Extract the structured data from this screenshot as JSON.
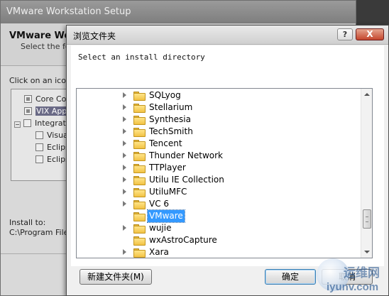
{
  "background_window": {
    "title": "VMware Workstation Setup",
    "header_title": "VMware Wo",
    "header_subtitle": "Select the fe",
    "click_text": "Click on an icon",
    "tree_items": [
      {
        "label": "Core Co",
        "checked": true
      },
      {
        "label": "VIX Appl",
        "checked": true,
        "highlighted": true
      },
      {
        "label": "Integrat",
        "expander": "−"
      },
      {
        "label": "Visua"
      },
      {
        "label": "Eclips"
      },
      {
        "label": "Eclips"
      }
    ],
    "install_to_label": "Install to:",
    "install_path": "C:\\Program Files"
  },
  "dialog": {
    "title": "浏览文件夹",
    "help_label": "?",
    "close_label": "X",
    "instruction": "Select an install directory",
    "folders": [
      {
        "label": "SQLyog",
        "expandable": true
      },
      {
        "label": "Stellarium",
        "expandable": true
      },
      {
        "label": "Synthesia",
        "expandable": true
      },
      {
        "label": "TechSmith",
        "expandable": true
      },
      {
        "label": "Tencent",
        "expandable": true
      },
      {
        "label": "Thunder Network",
        "expandable": true
      },
      {
        "label": "TTPlayer",
        "expandable": true
      },
      {
        "label": "Utilu IE Collection",
        "expandable": true
      },
      {
        "label": "UtiluMFC",
        "expandable": true
      },
      {
        "label": "VC 6",
        "expandable": true
      },
      {
        "label": "VMware",
        "expandable": false,
        "selected": true
      },
      {
        "label": "wujie",
        "expandable": true
      },
      {
        "label": "wxAstroCapture",
        "expandable": false
      },
      {
        "label": "Xara",
        "expandable": true
      }
    ],
    "new_folder_label": "新建文件夹(M)",
    "ok_label": "确定",
    "cancel_label": "取消"
  },
  "watermark": {
    "text": "运维网",
    "url": "iyunv.com"
  },
  "colors": {
    "selection": "#3399ff",
    "folder": "#f2c244"
  }
}
